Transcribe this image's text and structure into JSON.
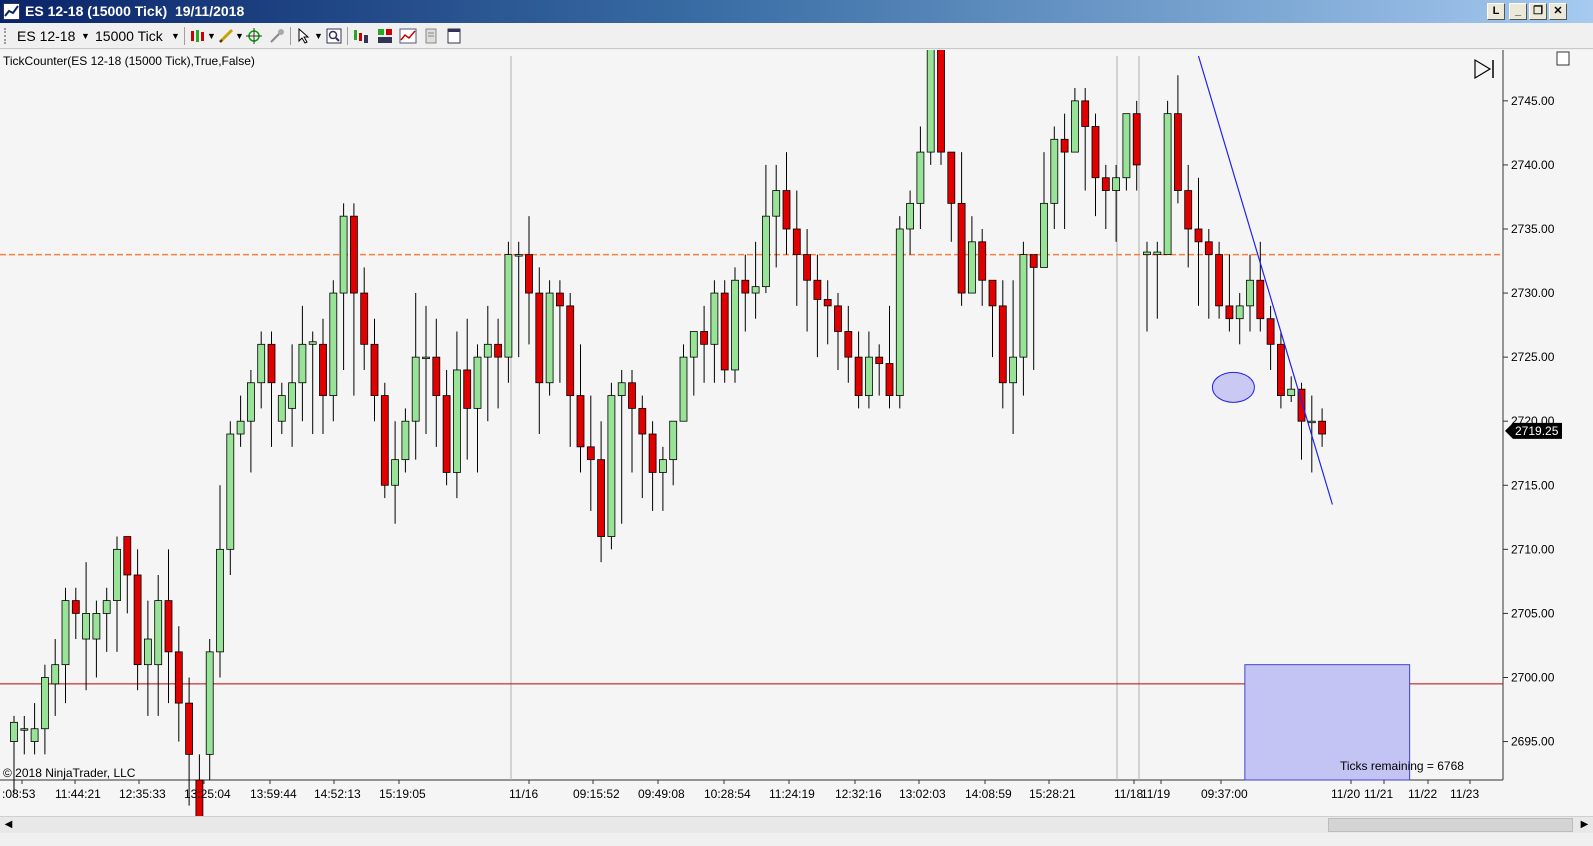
{
  "window": {
    "title": "ES 12-18 (15000 Tick)  19/11/2018",
    "buttons": {
      "l": "L",
      "minimize": "_",
      "restore": "❐",
      "close": "✕"
    }
  },
  "toolbar": {
    "instrument": "ES 12-18",
    "interval": "15000 Tick"
  },
  "indicator_label": "TickCounter(ES  12-18 (15000 Tick),True,False)",
  "copyright": "© 2018 NinjaTrader, LLC",
  "ticks_remaining": "Ticks remaining = 6768",
  "price_label": "2719.25",
  "colors": {
    "up": "#98e398",
    "down": "#e00000",
    "orange_line": "#ff7f3f",
    "red_line": "#c00000",
    "trendline": "#2222ee",
    "box_fill": "#c4c4f4",
    "box_stroke": "#4444cc"
  },
  "chart_data": {
    "type": "candlestick",
    "ylim": [
      2692.0,
      2748.5
    ],
    "y_ticks": [
      "2745.00",
      "2740.00",
      "2735.00",
      "2730.00",
      "2725.00",
      "2720.00",
      "2715.00",
      "2710.00",
      "2705.00",
      "2700.00",
      "2695.00"
    ],
    "x_labels": [
      ":08:53",
      "11:44:21",
      "12:35:33",
      "13:25:04",
      "13:59:44",
      "14:52:13",
      "15:19:05",
      "11/16",
      "09:15:52",
      "09:49:08",
      "10:28:54",
      "11:24:19",
      "12:32:16",
      "13:02:03",
      "14:08:59",
      "15:28:21",
      "11/18",
      "11/19",
      "09:37:00",
      "11/20",
      "11/21",
      "11/22",
      "11/23"
    ],
    "hlines": {
      "orange": 2733.0,
      "red": 2699.5
    },
    "candles": [
      [
        2695,
        2696.5,
        2691,
        2697
      ],
      [
        2696,
        2696,
        2694,
        2697
      ],
      [
        2695,
        2696,
        2694,
        2698
      ],
      [
        2696,
        2700,
        2694,
        2701
      ],
      [
        2699.5,
        2701,
        2697,
        2703
      ],
      [
        2701,
        2706,
        2698,
        2707
      ],
      [
        2706,
        2705,
        2703,
        2707
      ],
      [
        2703,
        2705,
        2699,
        2709
      ],
      [
        2703,
        2705,
        2700,
        2706
      ],
      [
        2705,
        2706,
        2702,
        2707
      ],
      [
        2706,
        2710,
        2702,
        2711
      ],
      [
        2711,
        2708,
        2705,
        2711
      ],
      [
        2708,
        2701,
        2699,
        2710
      ],
      [
        2701,
        2703,
        2697,
        2706
      ],
      [
        2701,
        2706,
        2697,
        2708
      ],
      [
        2706,
        2702,
        2698,
        2710
      ],
      [
        2702,
        2698,
        2695,
        2704
      ],
      [
        2698,
        2694,
        2690,
        2700
      ],
      [
        2692,
        2688,
        2686,
        2694
      ],
      [
        2694,
        2702,
        2692,
        2703
      ],
      [
        2702,
        2710,
        2700,
        2715
      ],
      [
        2710,
        2719,
        2708,
        2720
      ],
      [
        2719,
        2720,
        2718,
        2722
      ],
      [
        2720,
        2723,
        2716,
        2724
      ],
      [
        2723,
        2726,
        2721,
        2727
      ],
      [
        2726,
        2723,
        2718,
        2727
      ],
      [
        2720,
        2722,
        2719,
        2723
      ],
      [
        2721,
        2723,
        2718,
        2726
      ],
      [
        2723,
        2726,
        2720,
        2729
      ],
      [
        2726,
        2726.2,
        2719,
        2727
      ],
      [
        2726,
        2722,
        2719,
        2728
      ],
      [
        2722,
        2730,
        2720,
        2731
      ],
      [
        2730,
        2736,
        2724,
        2737
      ],
      [
        2736,
        2730,
        2722,
        2737
      ],
      [
        2730,
        2726,
        2724,
        2732
      ],
      [
        2726,
        2722,
        2720,
        2728
      ],
      [
        2722,
        2715,
        2714,
        2723
      ],
      [
        2715,
        2717,
        2712,
        2720
      ],
      [
        2717,
        2720,
        2716,
        2721
      ],
      [
        2720,
        2725,
        2717,
        2730
      ],
      [
        2725,
        2725,
        2719,
        2729
      ],
      [
        2725,
        2722,
        2718,
        2728
      ],
      [
        2722,
        2716,
        2715,
        2724
      ],
      [
        2716,
        2724,
        2714,
        2727
      ],
      [
        2724,
        2721,
        2717,
        2728
      ],
      [
        2721,
        2725,
        2716,
        2726
      ],
      [
        2725,
        2726,
        2720,
        2729
      ],
      [
        2726,
        2725,
        2721,
        2728
      ],
      [
        2725,
        2733,
        2723,
        2734
      ],
      [
        2733,
        2733,
        2725,
        2734
      ],
      [
        2733,
        2730,
        2726,
        2736
      ],
      [
        2730,
        2723,
        2719,
        2732
      ],
      [
        2723,
        2730,
        2722,
        2731
      ],
      [
        2730,
        2729,
        2723,
        2731
      ],
      [
        2729,
        2722,
        2718,
        2730
      ],
      [
        2722,
        2718,
        2716,
        2726
      ],
      [
        2718,
        2717,
        2713,
        2722
      ],
      [
        2717,
        2711,
        2709,
        2720
      ],
      [
        2711,
        2722,
        2710,
        2723
      ],
      [
        2722,
        2723,
        2712,
        2724
      ],
      [
        2723,
        2721,
        2716,
        2724
      ],
      [
        2721,
        2719,
        2714,
        2722
      ],
      [
        2719,
        2716,
        2713,
        2720
      ],
      [
        2716,
        2717,
        2713,
        2718
      ],
      [
        2717,
        2720,
        2715,
        2720
      ],
      [
        2720,
        2725,
        2720,
        2726
      ],
      [
        2725,
        2727,
        2722,
        2727
      ],
      [
        2727,
        2726,
        2723,
        2729
      ],
      [
        2726,
        2730,
        2723,
        2731
      ],
      [
        2730,
        2724,
        2723,
        2731
      ],
      [
        2724,
        2731,
        2723,
        2732
      ],
      [
        2731,
        2730,
        2727,
        2733
      ],
      [
        2730,
        2730.5,
        2728,
        2734
      ],
      [
        2730.5,
        2736,
        2730,
        2740
      ],
      [
        2736,
        2738,
        2732,
        2740
      ],
      [
        2738,
        2735,
        2733,
        2741
      ],
      [
        2735,
        2733,
        2729,
        2738
      ],
      [
        2733,
        2731,
        2727,
        2735
      ],
      [
        2731,
        2729.5,
        2725,
        2733
      ],
      [
        2729.5,
        2729,
        2726,
        2731
      ],
      [
        2729,
        2727,
        2724,
        2730
      ],
      [
        2727,
        2725,
        2723,
        2729
      ],
      [
        2725,
        2722,
        2721,
        2727
      ],
      [
        2722,
        2725,
        2721,
        2727
      ],
      [
        2725,
        2724.5,
        2722,
        2726
      ],
      [
        2724.5,
        2722,
        2721,
        2729
      ],
      [
        2722,
        2735,
        2721,
        2736
      ],
      [
        2735,
        2737,
        2733,
        2738
      ],
      [
        2737,
        2741,
        2735,
        2743
      ],
      [
        2741,
        2749,
        2740,
        2750
      ],
      [
        2749,
        2741,
        2740,
        2750
      ],
      [
        2741,
        2737,
        2734,
        2741
      ],
      [
        2737,
        2730,
        2729,
        2741
      ],
      [
        2730,
        2734,
        2730,
        2736
      ],
      [
        2734,
        2731,
        2729,
        2735
      ],
      [
        2731,
        2729,
        2725,
        2731
      ],
      [
        2729,
        2723,
        2721,
        2731
      ],
      [
        2723,
        2725,
        2719,
        2731
      ],
      [
        2725,
        2733,
        2722,
        2734
      ],
      [
        2733,
        2732,
        2724,
        2733
      ],
      [
        2732,
        2737,
        2732,
        2741
      ],
      [
        2737,
        2742,
        2735,
        2743
      ],
      [
        2742,
        2741,
        2735,
        2744
      ],
      [
        2741,
        2745,
        2742,
        2746
      ],
      [
        2745,
        2743,
        2738,
        2746
      ],
      [
        2743,
        2739,
        2736,
        2744
      ],
      [
        2739,
        2738,
        2735,
        2740
      ],
      [
        2738,
        2739,
        2734,
        2740
      ],
      [
        2739,
        2744,
        2738,
        2744
      ],
      [
        2744,
        2740,
        2738,
        2745
      ],
      [
        2733,
        2733.2,
        2727,
        2734
      ],
      [
        2733,
        2733.2,
        2728,
        2734
      ],
      [
        2733,
        2744,
        2733,
        2745
      ],
      [
        2744,
        2738,
        2737,
        2747
      ],
      [
        2738,
        2735,
        2732,
        2740
      ],
      [
        2735,
        2734,
        2729,
        2739
      ],
      [
        2734,
        2733,
        2728,
        2735
      ],
      [
        2733,
        2729,
        2728,
        2734
      ],
      [
        2729,
        2728,
        2727,
        2733
      ],
      [
        2728,
        2729,
        2726,
        2730
      ],
      [
        2729,
        2731,
        2727,
        2733
      ],
      [
        2731,
        2728,
        2727,
        2734
      ],
      [
        2728,
        2726,
        2724,
        2729
      ],
      [
        2726,
        2722,
        2721,
        2727
      ],
      [
        2722,
        2722.5,
        2721.5,
        2723.5
      ],
      [
        2722.5,
        2720,
        2717,
        2723
      ],
      [
        2720,
        2720,
        2716,
        2722
      ],
      [
        2720,
        2719,
        2718,
        2721
      ]
    ],
    "trendline": [
      [
        115,
        2748.5
      ],
      [
        128,
        2713.5
      ]
    ],
    "ellipse": {
      "index": 118,
      "price": 2722.8
    },
    "box": {
      "from_index": 119.5,
      "to_index": 135.5,
      "top": 2701,
      "bottom": 2692
    }
  }
}
